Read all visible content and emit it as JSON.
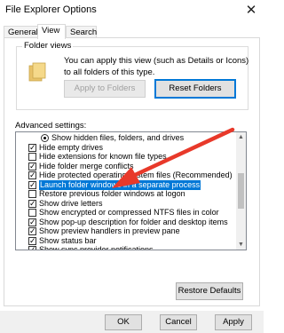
{
  "window": {
    "title": "File Explorer Options"
  },
  "tabs": [
    {
      "label": "General"
    },
    {
      "label": "View"
    },
    {
      "label": "Search"
    }
  ],
  "folder_views": {
    "legend": "Folder views",
    "description": "You can apply this view (such as Details or Icons) to all folders of this type.",
    "apply_label": "Apply to Folders",
    "reset_label": "Reset Folders"
  },
  "advanced": {
    "label": "Advanced settings:",
    "items": [
      {
        "label": "Show hidden files, folders, and drives",
        "type": "radio",
        "checked": true
      },
      {
        "label": "Hide empty drives",
        "type": "checkbox",
        "checked": true
      },
      {
        "label": "Hide extensions for known file types",
        "type": "checkbox",
        "checked": false
      },
      {
        "label": "Hide folder merge conflicts",
        "type": "checkbox",
        "checked": true
      },
      {
        "label": "Hide protected operating system files (Recommended)",
        "type": "checkbox",
        "checked": true
      },
      {
        "label": "Launch folder windows in a separate process",
        "type": "checkbox",
        "checked": true,
        "selected": true
      },
      {
        "label": "Restore previous folder windows at logon",
        "type": "checkbox",
        "checked": false
      },
      {
        "label": "Show drive letters",
        "type": "checkbox",
        "checked": true
      },
      {
        "label": "Show encrypted or compressed NTFS files in color",
        "type": "checkbox",
        "checked": false
      },
      {
        "label": "Show pop-up description for folder and desktop items",
        "type": "checkbox",
        "checked": true
      },
      {
        "label": "Show preview handlers in preview pane",
        "type": "checkbox",
        "checked": true
      },
      {
        "label": "Show status bar",
        "type": "checkbox",
        "checked": true
      },
      {
        "label": "Show sync provider notifications",
        "type": "checkbox",
        "checked": true
      },
      {
        "label": "Use check boxes to select items",
        "type": "checkbox",
        "checked": false
      }
    ],
    "restore_label": "Restore Defaults"
  },
  "footer": {
    "ok_label": "OK",
    "cancel_label": "Cancel",
    "apply_label": "Apply"
  },
  "colors": {
    "selection": "#0078d7",
    "arrow": "#e8392a"
  }
}
